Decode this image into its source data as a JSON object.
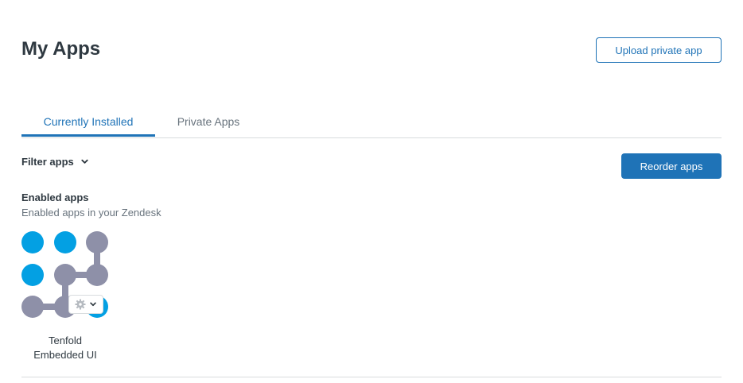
{
  "header": {
    "title": "My Apps",
    "upload_label": "Upload private app"
  },
  "tabs": [
    {
      "label": "Currently Installed",
      "active": true
    },
    {
      "label": "Private Apps",
      "active": false
    }
  ],
  "toolbar": {
    "filter_label": "Filter apps",
    "reorder_label": "Reorder apps"
  },
  "section": {
    "title": "Enabled apps",
    "subtitle": "Enabled apps in your Zendesk"
  },
  "apps": [
    {
      "name_line1": "Tenfold",
      "name_line2": "Embedded UI",
      "menu_icon": "gear-icon"
    }
  ],
  "colors": {
    "accent": "#1f73b7",
    "logo_blue": "#03a0e3",
    "logo_gray": "#8e90a8",
    "divider": "#d8dcde"
  }
}
